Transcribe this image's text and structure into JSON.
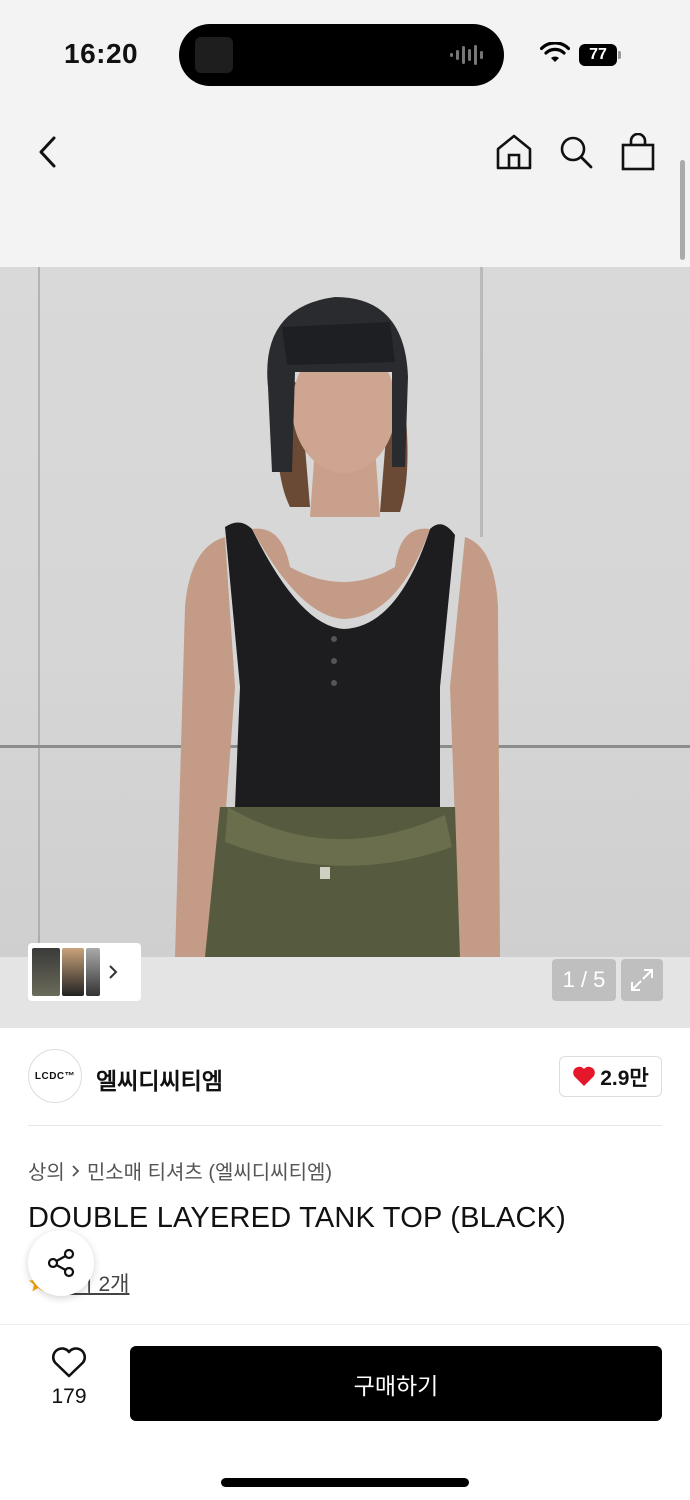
{
  "status_bar": {
    "time": "16:20",
    "battery": "77",
    "icons": [
      "wifi-icon",
      "battery-icon"
    ]
  },
  "header": {
    "icons": [
      "back-chevron-icon",
      "home-icon",
      "search-icon",
      "shopping-bag-icon"
    ]
  },
  "product_image": {
    "description_icons": [
      "image-thumbnail-strip",
      "expand-icon"
    ],
    "pager": "1 / 5"
  },
  "brand": {
    "logo_text": "LCDC™",
    "name": "엘씨디씨티엠",
    "likes": "2.9만"
  },
  "breadcrumb": {
    "category": "상의",
    "subcategory": "민소매 티셔츠 (엘씨디씨티엠)"
  },
  "product": {
    "title": "DOUBLE LAYERED TANK TOP (BLACK)",
    "review_text": "후기 2개",
    "review_visible_text": "후기 2개"
  },
  "bottom_bar": {
    "wish_count": "179",
    "buy_label": "구매하기"
  },
  "colors": {
    "accent_heart": "#e5172a",
    "buy_button": "#000000",
    "header_bg": "#f3f3f3"
  }
}
